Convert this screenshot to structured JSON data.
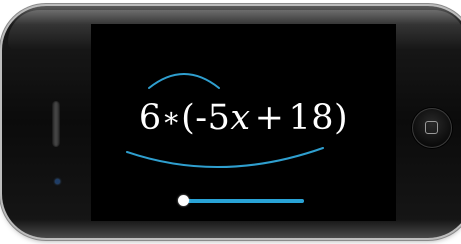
{
  "equation": {
    "coefficient": "6",
    "operator": "∗",
    "open_paren": "(",
    "term_coeff": "-5",
    "variable": "x",
    "plus": "+",
    "constant": "18",
    "close_paren": ")"
  },
  "slider": {
    "progress": 0.0
  },
  "colors": {
    "accent": "#29a3d6",
    "screen_bg": "#000000",
    "text": "#ffffff",
    "arc": "#2f9fcf"
  },
  "icons": {
    "home_button": "home-button-icon",
    "earpiece": "speaker-grille-icon",
    "camera": "camera-icon"
  }
}
